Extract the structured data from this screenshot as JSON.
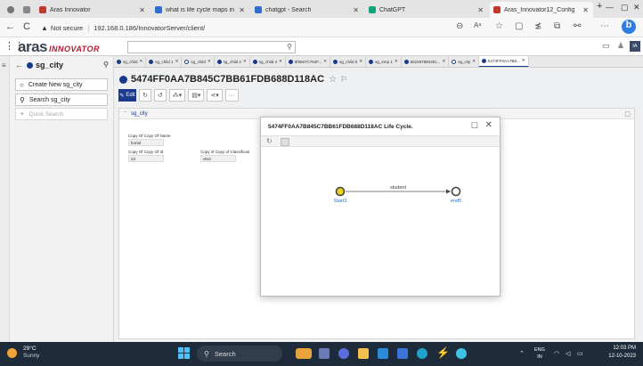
{
  "browser": {
    "tabs": [
      {
        "label": "",
        "color": "#666666"
      },
      {
        "label": "",
        "color": "#666666"
      },
      {
        "label": "Aras Innovator",
        "color": "#c0392b"
      },
      {
        "label": "what is life cycle maps in",
        "color": "#2c6fd1"
      },
      {
        "label": "chatgpt - Search",
        "color": "#2c6fd1"
      },
      {
        "label": "ChatGPT",
        "color": "#10a37f"
      },
      {
        "label": "Aras_Innovator12_Config",
        "color": "#c0392b"
      }
    ],
    "new_tab": "+",
    "window": {
      "minimize": "—",
      "restore": "▢",
      "close": "✕"
    },
    "back": "←",
    "refresh": "C",
    "security": "Not secure",
    "url": "192.168.0.186/InnovatorServer/client/"
  },
  "app": {
    "logo_main": "aras",
    "logo_sub": "INNOVATOR",
    "user_initials": "IA"
  },
  "sidebar": {
    "item_type": "sg_city",
    "create_label": "Create New sg_city",
    "search_label": "Search sg_city",
    "quick_search": "Quick Search"
  },
  "content": {
    "item_tabs": [
      {
        "label": "sg_child",
        "hollow": false
      },
      {
        "label": "sg_child 1",
        "hollow": false
      },
      {
        "label": "sg_child",
        "hollow": true
      },
      {
        "label": "sg_child 2",
        "hollow": false
      },
      {
        "label": "sg_child 3",
        "hollow": false
      },
      {
        "label": "5f8667C764F...",
        "hollow": false
      },
      {
        "label": "sg_child 5",
        "hollow": false
      },
      {
        "label": "sg_emp 1",
        "hollow": false
      },
      {
        "label": "652287880391...",
        "hollow": false
      },
      {
        "label": "sg_city",
        "hollow": true
      },
      {
        "label": "5474FF0AA7B8...",
        "hollow": false
      }
    ],
    "item_title": "5474FF0AA7B845C7BB61FDB688D118AC",
    "edit_label": "Edit",
    "more": "···",
    "form_tab": "sg_city",
    "fields": [
      {
        "label": "Copy Of Copy Of Name",
        "value": "bonal"
      },
      {
        "label": "Copy Of Copy Of Id",
        "value": "23"
      },
      {
        "label": "Copy of Copy of Classificati",
        "value": "vitez"
      }
    ]
  },
  "modal": {
    "title": "5474FF0AA7B845C7BB61FDB688D118AC Life Cycle.",
    "states": [
      {
        "name": "Start3",
        "color": "#1f6fd6"
      },
      {
        "name": "end5",
        "color": "#1f6fd6"
      }
    ],
    "transition_label": "student",
    "state_fill": "#e8d41a"
  },
  "taskbar": {
    "temp": "29°C",
    "weather": "Sunny",
    "search": "Search",
    "lang1": "ENG",
    "lang2": "IN",
    "time": "12:03 PM",
    "date": "12-10-2023"
  }
}
